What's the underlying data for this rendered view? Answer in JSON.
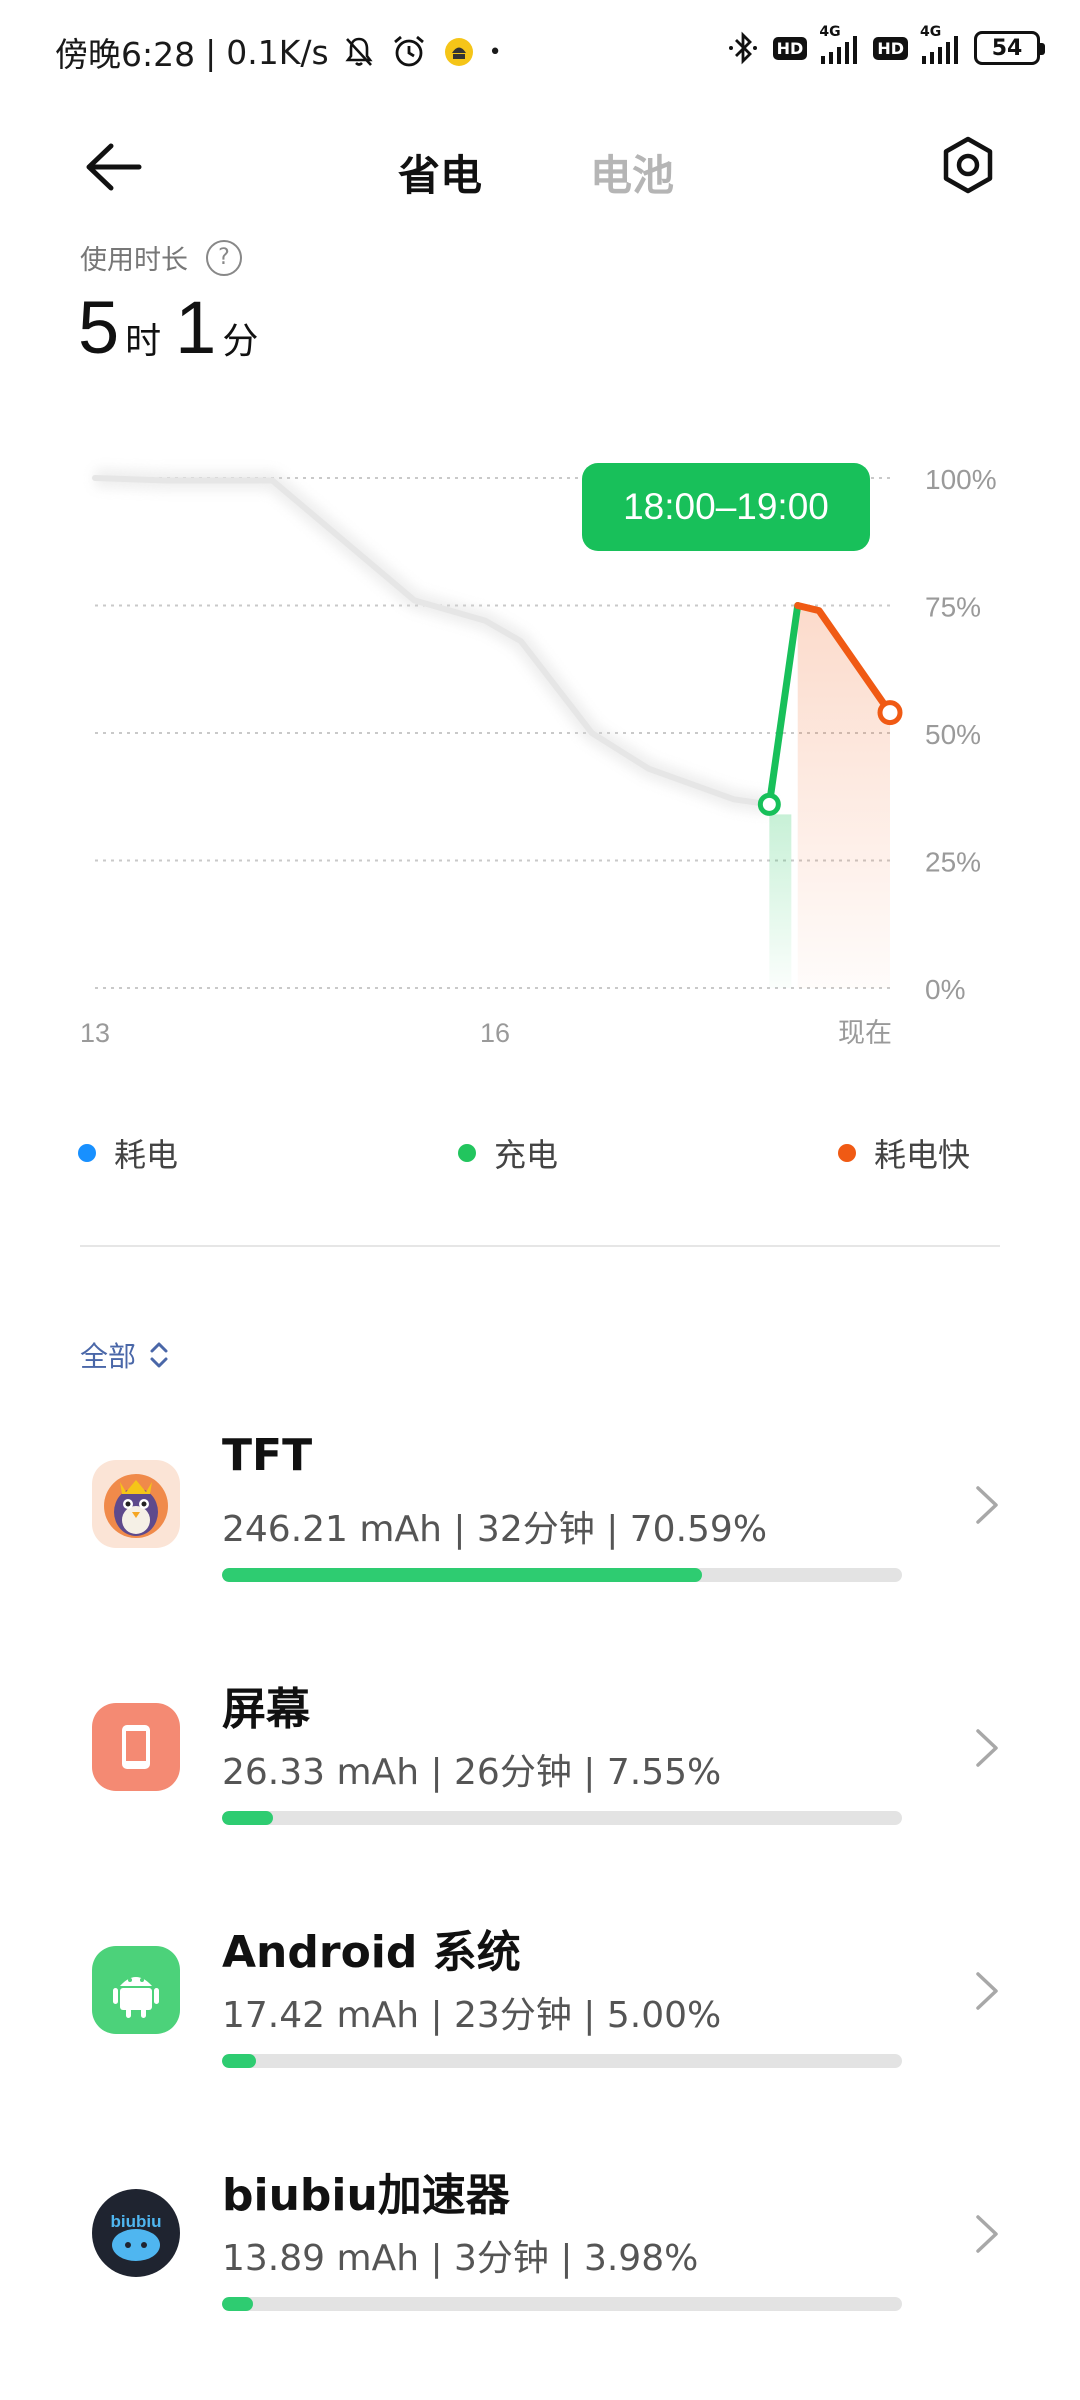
{
  "status_bar": {
    "time": "傍晚6:28",
    "speed": "0.1K/s",
    "separator": "|",
    "dot": "•",
    "net1": "4G",
    "net2": "4G",
    "hd": "HD",
    "battery": "54"
  },
  "header": {
    "tab_active": "省电",
    "tab_inactive": "电池"
  },
  "usage": {
    "label": "使用时长",
    "help": "?",
    "hours": "5",
    "hours_unit": "时",
    "minutes": "1",
    "minutes_unit": "分"
  },
  "chart_data": {
    "type": "line",
    "tooltip": "18:00–19:00",
    "y_tick_labels": [
      "100%",
      "75%",
      "50%",
      "25%",
      "0%"
    ],
    "x_tick_labels": [
      "13",
      "16",
      "现在"
    ],
    "ylim": [
      0,
      100
    ],
    "series": [
      {
        "name": "耗电",
        "values": [
          [
            0,
            100
          ],
          [
            0.1,
            99.5
          ],
          [
            0.25,
            99.5
          ],
          [
            0.45,
            76
          ],
          [
            0.55,
            72
          ],
          [
            0.6,
            68
          ],
          [
            0.7,
            50
          ],
          [
            0.78,
            43
          ],
          [
            0.9,
            37
          ],
          [
            0.95,
            36
          ]
        ]
      },
      {
        "name": "充电",
        "values": [
          [
            0.95,
            36
          ],
          [
            0.99,
            75
          ]
        ]
      },
      {
        "name": "耗电快",
        "values": [
          [
            0.99,
            75
          ],
          [
            1.02,
            74
          ],
          [
            1.12,
            54
          ]
        ]
      }
    ],
    "grid": true,
    "legend_position": "bottom"
  },
  "legend": [
    {
      "label": "耗电",
      "color": "#1890ff"
    },
    {
      "label": "充电",
      "color": "#22c55e"
    },
    {
      "label": "耗电快",
      "color": "#f05a14"
    }
  ],
  "filter": {
    "label": "全部"
  },
  "apps": [
    {
      "name": "TFT",
      "stats": "246.21 mAh | 32分钟 | 70.59%",
      "percent": 70.59,
      "icon": "tft-app-icon"
    },
    {
      "name": "屏幕",
      "stats": "26.33 mAh | 26分钟 | 7.55%",
      "percent": 7.55,
      "icon": "screen-icon"
    },
    {
      "name": "Android 系统",
      "stats": "17.42 mAh | 23分钟 | 5.00%",
      "percent": 5.0,
      "icon": "android-icon"
    },
    {
      "name": "biubiu加速器",
      "stats": "13.89 mAh | 3分钟 | 3.98%",
      "percent": 3.98,
      "icon": "biubiu-icon",
      "icon_text": "biubiu"
    }
  ]
}
